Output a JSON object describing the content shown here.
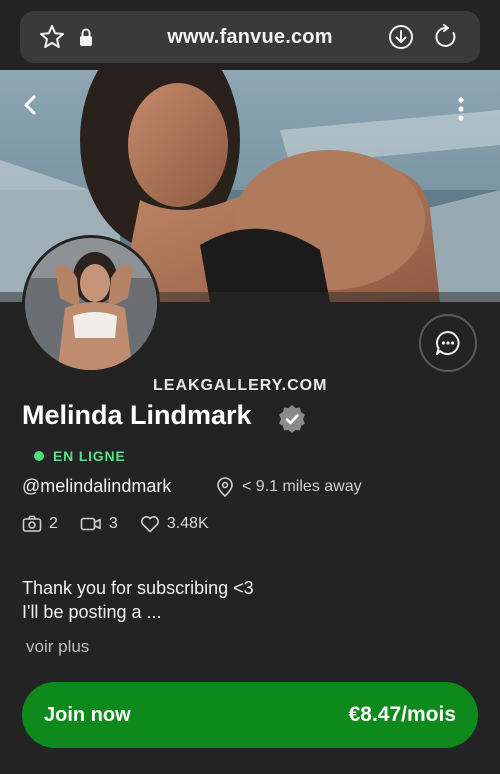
{
  "browser": {
    "url": "www.fanvue.com",
    "icons": [
      "star-icon",
      "lock-icon",
      "download-icon",
      "reload-icon"
    ]
  },
  "cover": {
    "icons": [
      "back-icon",
      "more-vertical-icon"
    ]
  },
  "watermark": "LEAKGALLERY.COM",
  "profile": {
    "name": "Melinda Lindmark",
    "status": "EN LIGNE",
    "handle": "@melindalindmark",
    "distance": "< 9.1 miles away",
    "stats": {
      "photos": "2",
      "videos": "3",
      "likes": "3.48K"
    },
    "bio_line1": "Thank you for subscribing <3",
    "bio_line2": "I'll be posting a ...",
    "more_label": "voir plus"
  },
  "subscribe": {
    "label": "Join now",
    "price": "€8.47/mois"
  },
  "colors": {
    "background": "#232323",
    "accent_green": "#0e8a1c",
    "online_green": "#58e08a"
  }
}
